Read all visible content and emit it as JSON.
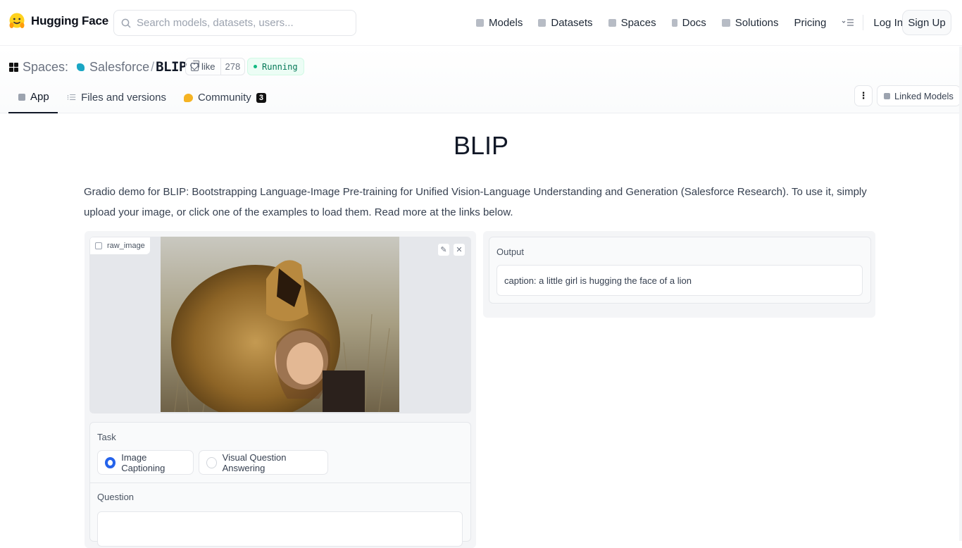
{
  "brand": {
    "name": "Hugging Face"
  },
  "search": {
    "placeholder": "Search models, datasets, users..."
  },
  "nav": {
    "items": [
      {
        "label": "Models"
      },
      {
        "label": "Datasets"
      },
      {
        "label": "Spaces"
      },
      {
        "label": "Docs"
      },
      {
        "label": "Solutions"
      },
      {
        "label": "Pricing"
      }
    ],
    "login": "Log In",
    "signup": "Sign Up"
  },
  "space": {
    "section": "Spaces:",
    "org": "Salesforce",
    "separator": "/",
    "repo": "BLIP",
    "like_label": "like",
    "like_count": "278",
    "status": "Running"
  },
  "tabs": [
    {
      "label": "App"
    },
    {
      "label": "Files and versions"
    },
    {
      "label": "Community",
      "badge": "3"
    }
  ],
  "linked_models": "Linked Models",
  "app": {
    "title": "BLIP",
    "description": "Gradio demo for BLIP: Bootstrapping Language-Image Pre-training for Unified Vision-Language Understanding and Generation (Salesforce Research). To use it, simply upload your image, or click one of the examples to load them. Read more at the links below.",
    "image_label": "raw_image",
    "task": {
      "label": "Task",
      "options": [
        "Image Captioning",
        "Visual Question Answering"
      ],
      "selected": "Image Captioning"
    },
    "question": {
      "label": "Question",
      "value": ""
    },
    "output": {
      "label": "Output",
      "value": "caption: a little girl is hugging the face of a lion"
    }
  },
  "colors": {
    "accent": "#2563eb",
    "running": "#047857",
    "brand": "#FFD21E"
  }
}
